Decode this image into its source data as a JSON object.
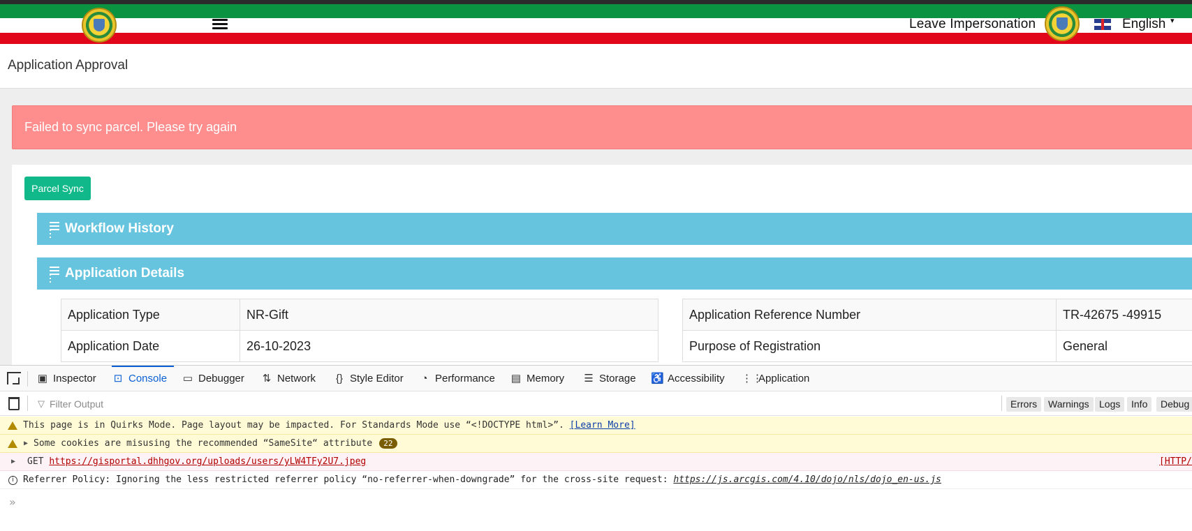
{
  "header": {
    "leave_impersonation": "Leave Impersonation",
    "language": "English",
    "colors": {
      "green": "#0a9441",
      "red": "#e1061a"
    }
  },
  "page": {
    "title": "Application Approval"
  },
  "alert": {
    "message": "Failed to sync parcel. Please try again",
    "color": "#fe8d8d"
  },
  "actions": {
    "parcel_sync": "Parcel Sync"
  },
  "sections": {
    "workflow_history": "Workflow History",
    "application_details": "Application Details"
  },
  "details": {
    "left": [
      {
        "label": "Application Type",
        "value": "NR-Gift"
      },
      {
        "label": "Application Date",
        "value": "26-10-2023"
      }
    ],
    "right": [
      {
        "label": "Application Reference Number",
        "value": "TR-42675 -49915"
      },
      {
        "label": "Purpose of Registration",
        "value": "General"
      }
    ]
  },
  "devtools": {
    "tabs": [
      {
        "label": "Inspector",
        "icon": "inspector-icon"
      },
      {
        "label": "Console",
        "icon": "console-icon"
      },
      {
        "label": "Debugger",
        "icon": "debugger-icon"
      },
      {
        "label": "Network",
        "icon": "network-icon"
      },
      {
        "label": "Style Editor",
        "icon": "style-editor-icon"
      },
      {
        "label": "Performance",
        "icon": "performance-icon"
      },
      {
        "label": "Memory",
        "icon": "memory-icon"
      },
      {
        "label": "Storage",
        "icon": "storage-icon"
      },
      {
        "label": "Accessibility",
        "icon": "accessibility-icon"
      },
      {
        "label": "Application",
        "icon": "application-icon"
      }
    ],
    "filter_placeholder": "Filter Output",
    "filters": [
      "Errors",
      "Warnings",
      "Logs",
      "Info",
      "Debug"
    ],
    "messages": {
      "quirks": "This page is in Quirks Mode. Page layout may be impacted. For Standards Mode use “<!DOCTYPE html>”.",
      "quirks_link": "[Learn More]",
      "cookies": "Some cookies are misusing the recommended “SameSite“ attribute",
      "cookies_count": "22",
      "get_method": "GET",
      "get_url": "https://gisportal.dhhgov.org/uploads/users/yLW4TFy2U7.jpeg",
      "get_status": "[HTTP/",
      "referrer": "Referrer Policy: Ignoring the less restricted referrer policy “no-referrer-when-downgrade” for the cross-site request:",
      "referrer_url": "https://js.arcgis.com/4.10/dojo/nls/dojo_en-us.js"
    }
  }
}
